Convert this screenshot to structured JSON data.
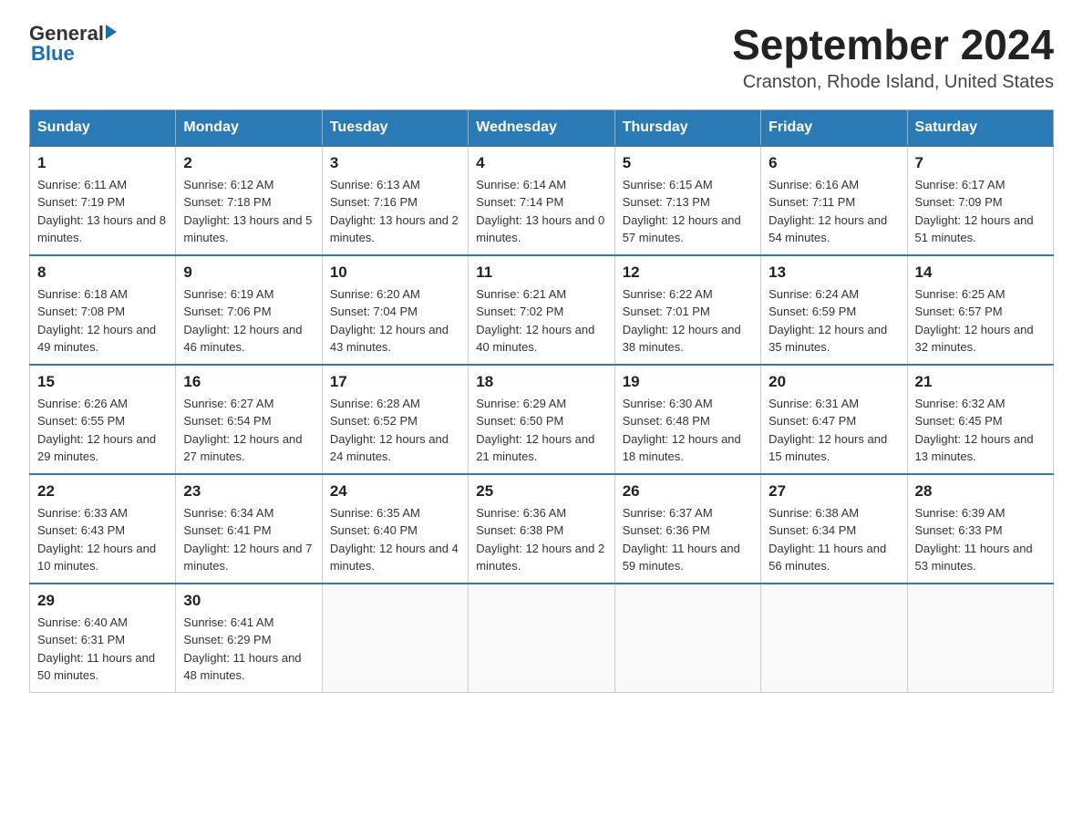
{
  "header": {
    "logo_general": "General",
    "logo_blue": "Blue",
    "title": "September 2024",
    "subtitle": "Cranston, Rhode Island, United States"
  },
  "days_of_week": [
    "Sunday",
    "Monday",
    "Tuesday",
    "Wednesday",
    "Thursday",
    "Friday",
    "Saturday"
  ],
  "weeks": [
    [
      {
        "day": "1",
        "sunrise": "6:11 AM",
        "sunset": "7:19 PM",
        "daylight": "13 hours and 8 minutes."
      },
      {
        "day": "2",
        "sunrise": "6:12 AM",
        "sunset": "7:18 PM",
        "daylight": "13 hours and 5 minutes."
      },
      {
        "day": "3",
        "sunrise": "6:13 AM",
        "sunset": "7:16 PM",
        "daylight": "13 hours and 2 minutes."
      },
      {
        "day": "4",
        "sunrise": "6:14 AM",
        "sunset": "7:14 PM",
        "daylight": "13 hours and 0 minutes."
      },
      {
        "day": "5",
        "sunrise": "6:15 AM",
        "sunset": "7:13 PM",
        "daylight": "12 hours and 57 minutes."
      },
      {
        "day": "6",
        "sunrise": "6:16 AM",
        "sunset": "7:11 PM",
        "daylight": "12 hours and 54 minutes."
      },
      {
        "day": "7",
        "sunrise": "6:17 AM",
        "sunset": "7:09 PM",
        "daylight": "12 hours and 51 minutes."
      }
    ],
    [
      {
        "day": "8",
        "sunrise": "6:18 AM",
        "sunset": "7:08 PM",
        "daylight": "12 hours and 49 minutes."
      },
      {
        "day": "9",
        "sunrise": "6:19 AM",
        "sunset": "7:06 PM",
        "daylight": "12 hours and 46 minutes."
      },
      {
        "day": "10",
        "sunrise": "6:20 AM",
        "sunset": "7:04 PM",
        "daylight": "12 hours and 43 minutes."
      },
      {
        "day": "11",
        "sunrise": "6:21 AM",
        "sunset": "7:02 PM",
        "daylight": "12 hours and 40 minutes."
      },
      {
        "day": "12",
        "sunrise": "6:22 AM",
        "sunset": "7:01 PM",
        "daylight": "12 hours and 38 minutes."
      },
      {
        "day": "13",
        "sunrise": "6:24 AM",
        "sunset": "6:59 PM",
        "daylight": "12 hours and 35 minutes."
      },
      {
        "day": "14",
        "sunrise": "6:25 AM",
        "sunset": "6:57 PM",
        "daylight": "12 hours and 32 minutes."
      }
    ],
    [
      {
        "day": "15",
        "sunrise": "6:26 AM",
        "sunset": "6:55 PM",
        "daylight": "12 hours and 29 minutes."
      },
      {
        "day": "16",
        "sunrise": "6:27 AM",
        "sunset": "6:54 PM",
        "daylight": "12 hours and 27 minutes."
      },
      {
        "day": "17",
        "sunrise": "6:28 AM",
        "sunset": "6:52 PM",
        "daylight": "12 hours and 24 minutes."
      },
      {
        "day": "18",
        "sunrise": "6:29 AM",
        "sunset": "6:50 PM",
        "daylight": "12 hours and 21 minutes."
      },
      {
        "day": "19",
        "sunrise": "6:30 AM",
        "sunset": "6:48 PM",
        "daylight": "12 hours and 18 minutes."
      },
      {
        "day": "20",
        "sunrise": "6:31 AM",
        "sunset": "6:47 PM",
        "daylight": "12 hours and 15 minutes."
      },
      {
        "day": "21",
        "sunrise": "6:32 AM",
        "sunset": "6:45 PM",
        "daylight": "12 hours and 13 minutes."
      }
    ],
    [
      {
        "day": "22",
        "sunrise": "6:33 AM",
        "sunset": "6:43 PM",
        "daylight": "12 hours and 10 minutes."
      },
      {
        "day": "23",
        "sunrise": "6:34 AM",
        "sunset": "6:41 PM",
        "daylight": "12 hours and 7 minutes."
      },
      {
        "day": "24",
        "sunrise": "6:35 AM",
        "sunset": "6:40 PM",
        "daylight": "12 hours and 4 minutes."
      },
      {
        "day": "25",
        "sunrise": "6:36 AM",
        "sunset": "6:38 PM",
        "daylight": "12 hours and 2 minutes."
      },
      {
        "day": "26",
        "sunrise": "6:37 AM",
        "sunset": "6:36 PM",
        "daylight": "11 hours and 59 minutes."
      },
      {
        "day": "27",
        "sunrise": "6:38 AM",
        "sunset": "6:34 PM",
        "daylight": "11 hours and 56 minutes."
      },
      {
        "day": "28",
        "sunrise": "6:39 AM",
        "sunset": "6:33 PM",
        "daylight": "11 hours and 53 minutes."
      }
    ],
    [
      {
        "day": "29",
        "sunrise": "6:40 AM",
        "sunset": "6:31 PM",
        "daylight": "11 hours and 50 minutes."
      },
      {
        "day": "30",
        "sunrise": "6:41 AM",
        "sunset": "6:29 PM",
        "daylight": "11 hours and 48 minutes."
      },
      null,
      null,
      null,
      null,
      null
    ]
  ]
}
